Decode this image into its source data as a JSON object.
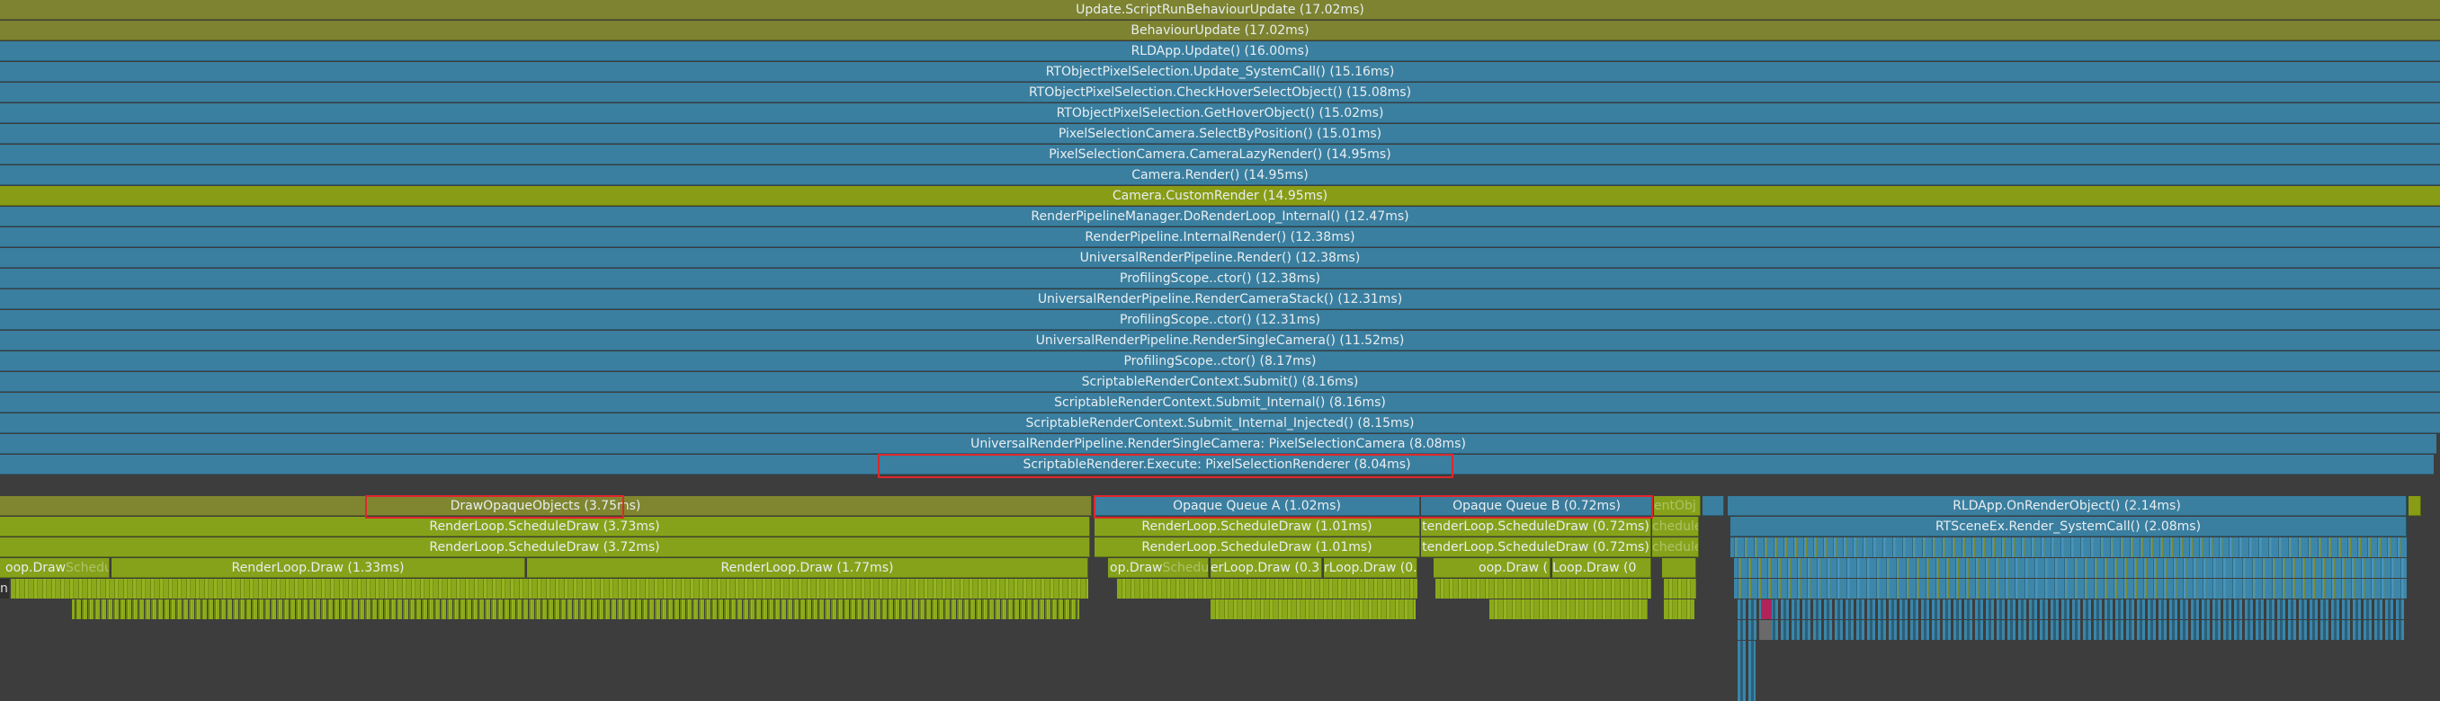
{
  "window": {
    "title": "CPU Usage Timeline - Flame View"
  },
  "rows": [
    {
      "label": "Update.ScriptRunBehaviourUpdate (17.02ms)",
      "color": "#7d8330"
    },
    {
      "label": "BehaviourUpdate (17.02ms)",
      "color": "#7d8330"
    },
    {
      "label": "RLDApp.Update() (16.00ms)",
      "color": "#3a7fa0"
    },
    {
      "label": "RTObjectPixelSelection.Update_SystemCall() (15.16ms)",
      "color": "#3a7fa0"
    },
    {
      "label": "RTObjectPixelSelection.CheckHoverSelectObject() (15.08ms)",
      "color": "#3a7fa0"
    },
    {
      "label": "RTObjectPixelSelection.GetHoverObject() (15.02ms)",
      "color": "#3a7fa0"
    },
    {
      "label": "PixelSelectionCamera.SelectByPosition() (15.01ms)",
      "color": "#3a7fa0"
    },
    {
      "label": "PixelSelectionCamera.CameraLazyRender() (14.95ms)",
      "color": "#3a7fa0"
    },
    {
      "label": "Camera.Render() (14.95ms)",
      "color": "#3a7fa0"
    },
    {
      "label": "Camera.CustomRender (14.95ms)",
      "color": "#889c16"
    },
    {
      "label": "RenderPipelineManager.DoRenderLoop_Internal() (12.47ms)",
      "color": "#3a7fa0"
    },
    {
      "label": "RenderPipeline.InternalRender() (12.38ms)",
      "color": "#3a7fa0"
    },
    {
      "label": "UniversalRenderPipeline.Render() (12.38ms)",
      "color": "#3a7fa0"
    },
    {
      "label": "ProfilingScope..ctor() (12.38ms)",
      "color": "#3a7fa0"
    },
    {
      "label": "UniversalRenderPipeline.RenderCameraStack() (12.31ms)",
      "color": "#3a7fa0"
    },
    {
      "label": "ProfilingScope..ctor() (12.31ms)",
      "color": "#3a7fa0"
    },
    {
      "label": "UniversalRenderPipeline.RenderSingleCamera() (11.52ms)",
      "color": "#3a7fa0"
    },
    {
      "label": "ProfilingScope..ctor() (8.17ms)",
      "color": "#3a7fa0"
    },
    {
      "label": "ScriptableRenderContext.Submit() (8.16ms)",
      "color": "#3a7fa0"
    },
    {
      "label": "ScriptableRenderContext.Submit_Internal() (8.16ms)",
      "color": "#3a7fa0"
    },
    {
      "label": "ScriptableRenderContext.Submit_Internal_Injected() (8.15ms)",
      "color": "#3a7fa0"
    },
    {
      "label": "UniversalRenderPipeline.RenderSingleCamera: PixelSelectionCamera (8.08ms)",
      "color": "#3a7fa0"
    },
    {
      "label": "ScriptableRenderer.Execute: PixelSelectionRenderer (8.04ms)",
      "color": "#3a7fa0"
    }
  ],
  "row23": {
    "draw_opaque": "DrawOpaqueObjects (3.75ms)",
    "queue_a": "Opaque Queue A (1.02ms)",
    "queue_b": "Opaque Queue B (0.72ms)",
    "event_obj": "entObj",
    "rld_render": "RLDApp.OnRenderObject() (2.14ms)"
  },
  "row24": {
    "schedule_a": "RenderLoop.ScheduleDraw (3.73ms)",
    "schedule_b": "RenderLoop.ScheduleDraw (1.01ms)",
    "schedule_c": "tenderLoop.ScheduleDraw (0.72ms)",
    "schedule_d": "chedule",
    "rtscene": "RTSceneEx.Render_SystemCall() (2.08ms)"
  },
  "row25": {
    "schedule_a": "RenderLoop.ScheduleDraw (3.72ms)",
    "schedule_b": "RenderLoop.ScheduleDraw (1.01ms)",
    "schedule_c": "tenderLoop.ScheduleDraw (0.72ms)",
    "schedule_d": "chedule"
  },
  "row26": {
    "loop_draw_small": "oop.Draw",
    "loop_draw_ghost": "ScheduleDraw",
    "loop_draw_a": "RenderLoop.Draw (1.33ms)",
    "loop_draw_b": "RenderLoop.Draw (1.77ms)",
    "loop_draw_c": "op.Draw",
    "loop_draw_c_ghost": "ScheduleDraw",
    "loop_draw_d": "erLoop.Draw (0.3",
    "loop_draw_e": "rLoop.Draw (0.",
    "loop_draw_f": "oop.Draw (",
    "loop_draw_g": "Loop.Draw (0",
    "left_n": "n"
  }
}
